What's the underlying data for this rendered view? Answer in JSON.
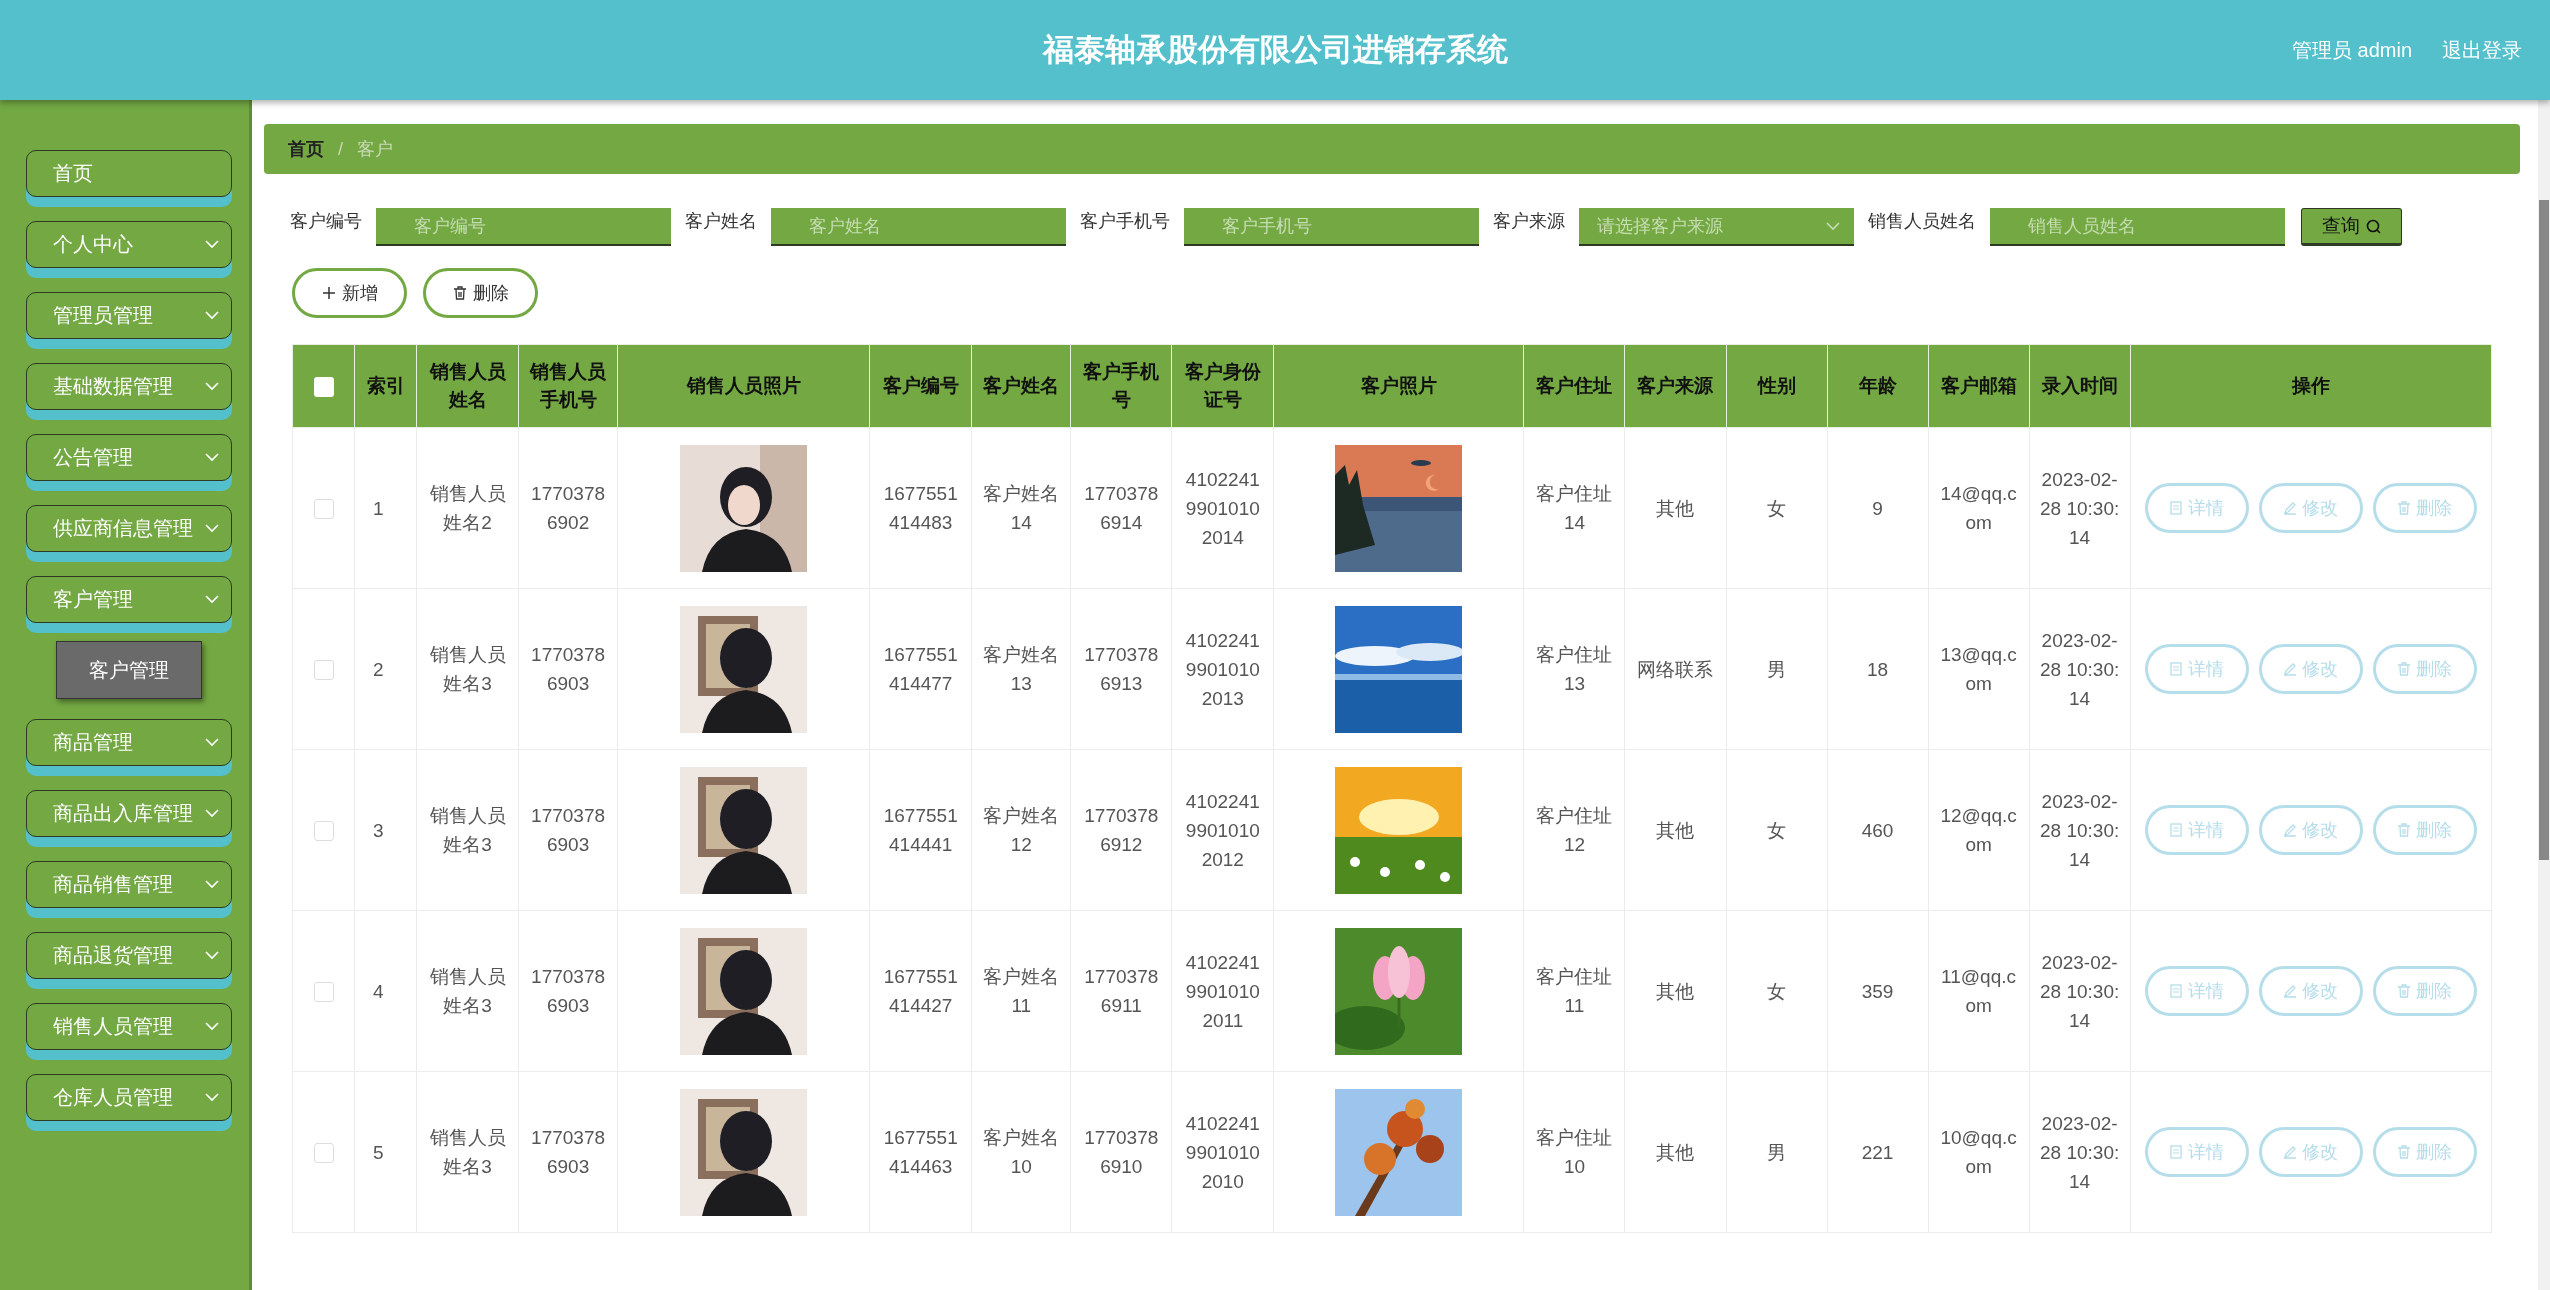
{
  "header": {
    "title": "福泰轴承股份有限公司进销存系统",
    "user": "管理员 admin",
    "logout": "退出登录"
  },
  "sidebar": {
    "items": [
      {
        "label": "首页",
        "has_arrow": false
      },
      {
        "label": "个人中心",
        "has_arrow": true
      },
      {
        "label": "管理员管理",
        "has_arrow": true
      },
      {
        "label": "基础数据管理",
        "has_arrow": true
      },
      {
        "label": "公告管理",
        "has_arrow": true
      },
      {
        "label": "供应商信息管理",
        "has_arrow": true
      },
      {
        "label": "客户管理",
        "has_arrow": true,
        "children": [
          {
            "label": "客户管理",
            "selected": true
          }
        ]
      },
      {
        "label": "商品管理",
        "has_arrow": true
      },
      {
        "label": "商品出入库管理",
        "has_arrow": true
      },
      {
        "label": "商品销售管理",
        "has_arrow": true
      },
      {
        "label": "商品退货管理",
        "has_arrow": true
      },
      {
        "label": "销售人员管理",
        "has_arrow": true
      },
      {
        "label": "仓库人员管理",
        "has_arrow": true
      }
    ]
  },
  "breadcrumb": [
    "首页",
    "/",
    "客户"
  ],
  "search": {
    "fields": [
      {
        "label": "客户编号",
        "kind": "text",
        "placeholder": "客户编号"
      },
      {
        "label": "客户姓名",
        "kind": "text",
        "placeholder": "客户姓名"
      },
      {
        "label": "客户手机号",
        "kind": "text",
        "placeholder": "客户手机号"
      },
      {
        "label": "客户来源",
        "kind": "select",
        "placeholder": "请选择客户来源"
      },
      {
        "label": "销售人员姓名",
        "kind": "text",
        "placeholder": "销售人员姓名"
      }
    ],
    "button": "查询"
  },
  "actions": [
    {
      "label": "新增",
      "kind": "add"
    },
    {
      "label": "删除",
      "kind": "delete"
    }
  ],
  "table": {
    "select_all": {
      "checked": false
    },
    "columns": [
      "索引",
      "销售人员姓名",
      "销售人员手机号",
      "销售人员照片",
      "客户编号",
      "客户姓名",
      "客户手机号",
      "客户身份证号",
      "客户照片",
      "客户住址",
      "客户来源",
      "性别",
      "年龄",
      "客户邮箱",
      "录入时间",
      "操作"
    ],
    "rows": [
      {
        "checked": false,
        "index": "1",
        "sales_name": "销售人员姓名2",
        "sales_phone": "17703786902",
        "customer_no": "1677551414483",
        "customer_name": "客户姓名14",
        "customer_phone": "17703786914",
        "id_card": "410224199010102014",
        "address": "客户住址14",
        "source": "其他",
        "gender": "女",
        "age": "9",
        "email": "14@qq.com",
        "created": "2023-02-28 10:30:14",
        "buttons": [
          "详情",
          "修改",
          "删除"
        ]
      },
      {
        "checked": false,
        "index": "2",
        "sales_name": "销售人员姓名3",
        "sales_phone": "17703786903",
        "customer_no": "1677551414477",
        "customer_name": "客户姓名13",
        "customer_phone": "17703786913",
        "id_card": "410224199010102013",
        "address": "客户住址13",
        "source": "网络联系",
        "gender": "男",
        "age": "18",
        "email": "13@qq.com",
        "created": "2023-02-28 10:30:14",
        "buttons": [
          "详情",
          "修改",
          "删除"
        ]
      },
      {
        "checked": false,
        "index": "3",
        "sales_name": "销售人员姓名3",
        "sales_phone": "17703786903",
        "customer_no": "1677551414441",
        "customer_name": "客户姓名12",
        "customer_phone": "17703786912",
        "id_card": "410224199010102012",
        "address": "客户住址12",
        "source": "其他",
        "gender": "女",
        "age": "460",
        "email": "12@qq.com",
        "created": "2023-02-28 10:30:14",
        "buttons": [
          "详情",
          "修改",
          "删除"
        ]
      },
      {
        "checked": false,
        "index": "4",
        "sales_name": "销售人员姓名3",
        "sales_phone": "17703786903",
        "customer_no": "1677551414427",
        "customer_name": "客户姓名11",
        "customer_phone": "17703786911",
        "id_card": "410224199010102011",
        "address": "客户住址11",
        "source": "其他",
        "gender": "女",
        "age": "359",
        "email": "11@qq.com",
        "created": "2023-02-28 10:30:14",
        "buttons": [
          "详情",
          "修改",
          "删除"
        ]
      },
      {
        "checked": false,
        "index": "5",
        "sales_name": "销售人员姓名3",
        "sales_phone": "17703786903",
        "customer_no": "1677551414463",
        "customer_name": "客户姓名10",
        "customer_phone": "17703786910",
        "id_card": "410224199010102010",
        "address": "客户住址10",
        "source": "其他",
        "gender": "男",
        "age": "221",
        "email": "10@qq.com",
        "created": "2023-02-28 10:30:14",
        "buttons": [
          "详情",
          "修改",
          "删除"
        ]
      }
    ]
  }
}
